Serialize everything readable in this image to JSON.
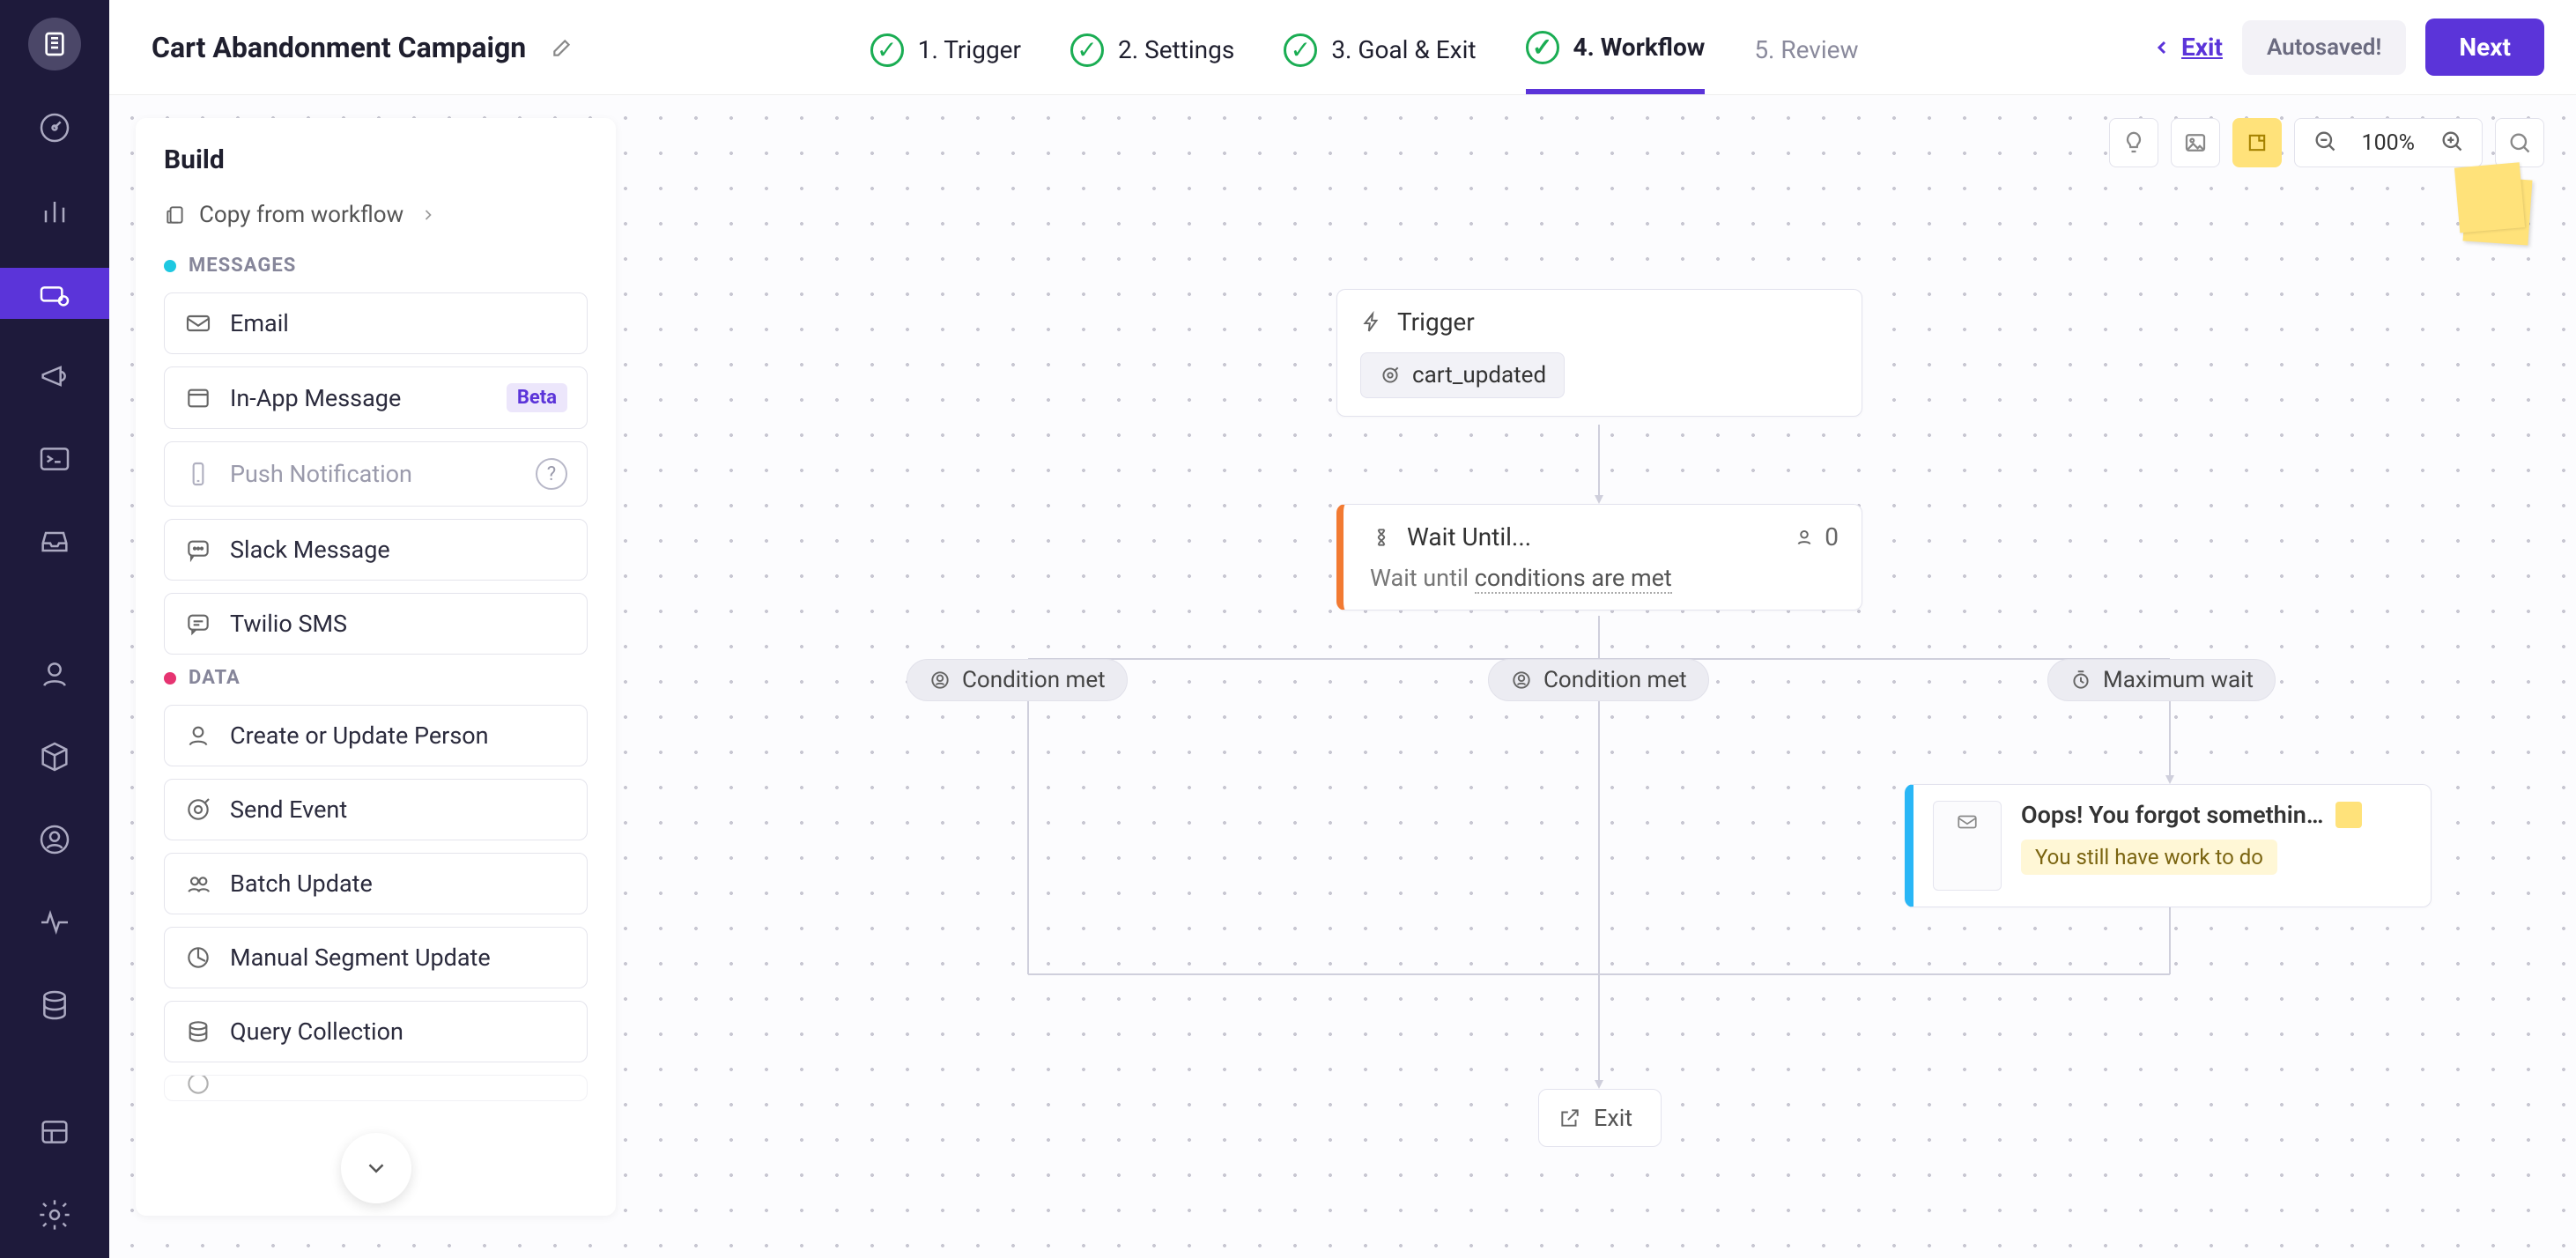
{
  "header": {
    "title": "Cart Abandonment Campaign",
    "exit_label": "Exit",
    "autosave_label": "Autosaved!",
    "next_label": "Next"
  },
  "steps": [
    {
      "label": "1. Trigger",
      "done": true
    },
    {
      "label": "2. Settings",
      "done": true
    },
    {
      "label": "3. Goal & Exit",
      "done": true
    },
    {
      "label": "4. Workflow",
      "done": true,
      "current": true
    },
    {
      "label": "5. Review",
      "done": false
    }
  ],
  "panel": {
    "title": "Build",
    "copy_label": "Copy from workflow",
    "sections": {
      "messages_label": "MESSAGES",
      "data_label": "DATA"
    },
    "messages": [
      {
        "label": "Email",
        "icon": "mail"
      },
      {
        "label": "In-App Message",
        "icon": "window",
        "badge": "Beta"
      },
      {
        "label": "Push Notification",
        "icon": "phone",
        "disabled": true,
        "help": true
      },
      {
        "label": "Slack Message",
        "icon": "chat"
      },
      {
        "label": "Twilio SMS",
        "icon": "sms"
      }
    ],
    "data_items": [
      {
        "label": "Create or Update Person",
        "icon": "user"
      },
      {
        "label": "Send Event",
        "icon": "target"
      },
      {
        "label": "Batch Update",
        "icon": "users"
      },
      {
        "label": "Manual Segment Update",
        "icon": "segment"
      },
      {
        "label": "Query Collection",
        "icon": "db"
      }
    ]
  },
  "tools": {
    "zoom_label": "100%"
  },
  "workflow": {
    "trigger": {
      "title": "Trigger",
      "event": "cart_updated"
    },
    "wait": {
      "title": "Wait Until...",
      "subtitle_prefix": "Wait until ",
      "subtitle_cond": "conditions are met",
      "count": "0"
    },
    "branches": {
      "left": "Condition met",
      "mid": "Condition met",
      "right": "Maximum wait"
    },
    "email": {
      "title": "Oops! You forgot somethin…",
      "warn": "You still have work to do"
    },
    "exit_label": "Exit"
  }
}
